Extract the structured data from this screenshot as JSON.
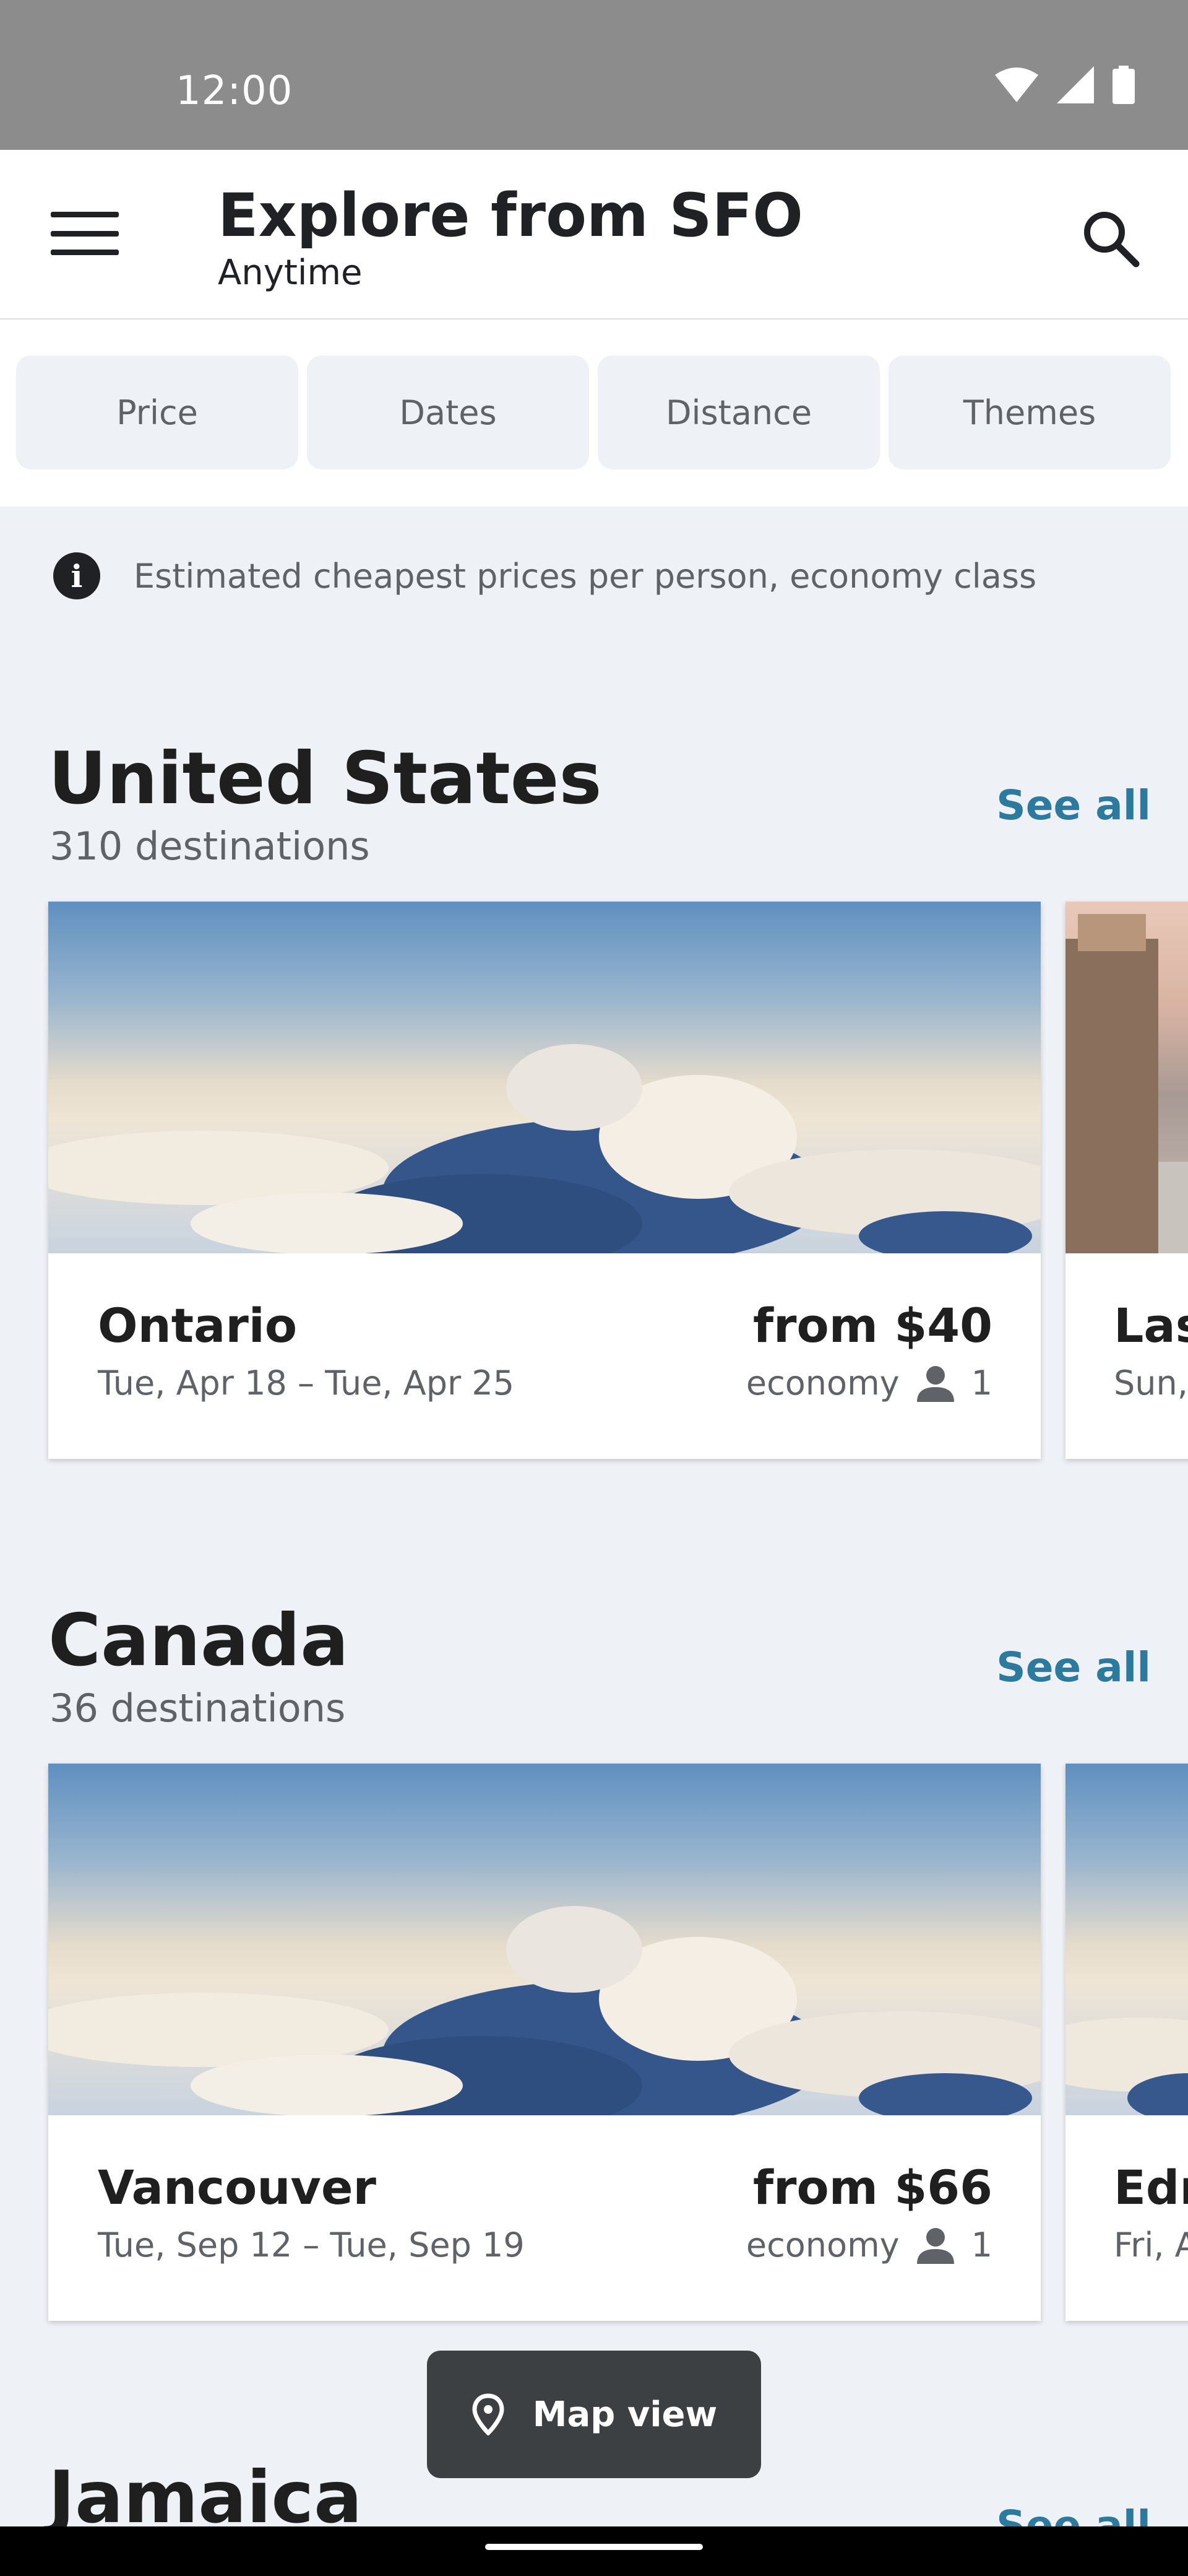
{
  "status_bar": {
    "time": "12:00"
  },
  "app_bar": {
    "title": "Explore from SFO",
    "subtitle": "Anytime"
  },
  "filters": [
    "Price",
    "Dates",
    "Distance",
    "Themes"
  ],
  "info_text": "Estimated cheapest prices per person, economy class",
  "sections": [
    {
      "title": "United States",
      "subtitle": "310 destinations",
      "see_all": "See all",
      "card": {
        "city": "Ontario",
        "dates": "Tue, Apr 18 – Tue, Apr 25",
        "price": "from $40",
        "cabin": "economy",
        "passengers": "1"
      },
      "peek": {
        "city": "Las",
        "dates": "Sun,"
      }
    },
    {
      "title": "Canada",
      "subtitle": "36 destinations",
      "see_all": "See all",
      "card": {
        "city": "Vancouver",
        "dates": "Tue, Sep 12 – Tue, Sep 19",
        "price": "from $66",
        "cabin": "economy",
        "passengers": "1"
      },
      "peek": {
        "city": "Edr",
        "dates": "Fri, A"
      }
    },
    {
      "title": "Jamaica",
      "see_all": "See all"
    }
  ],
  "map_view_label": "Map view",
  "colors": {
    "accent": "#2c7a9e",
    "background": "#eef1f6",
    "fab": "#3c4043"
  }
}
